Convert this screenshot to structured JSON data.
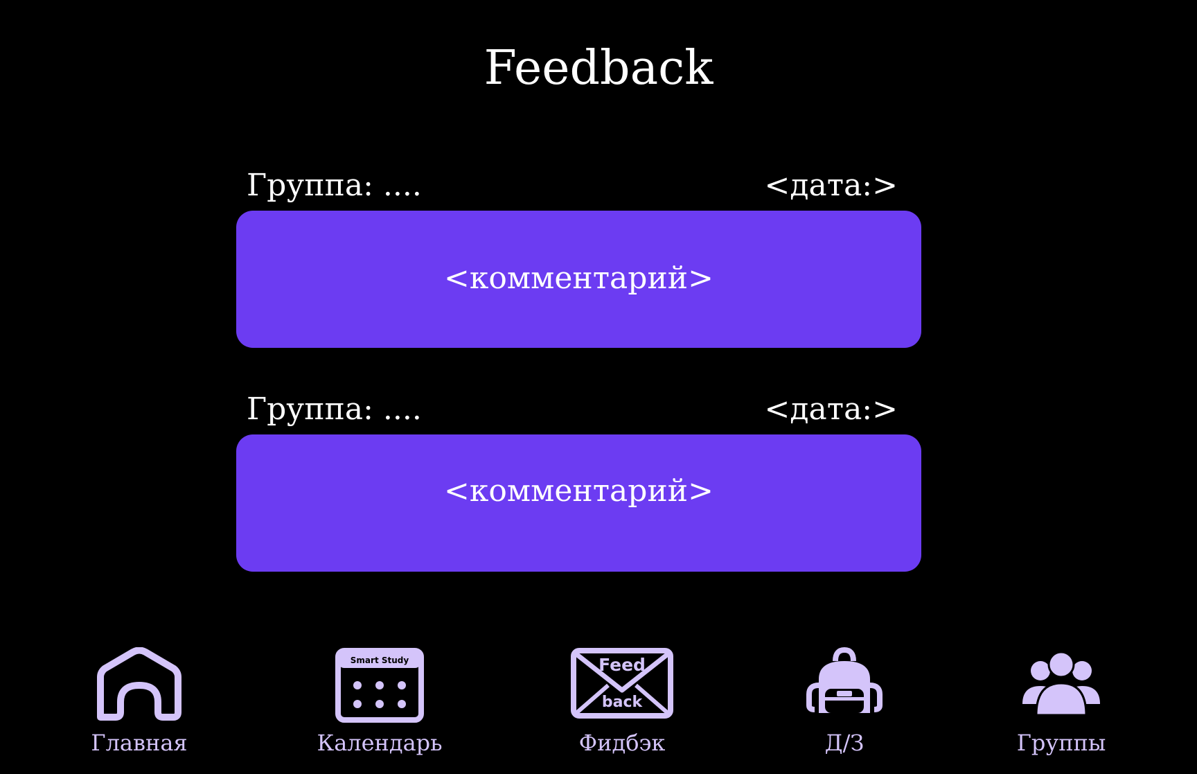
{
  "page": {
    "title": "Feedback"
  },
  "feedback_items": [
    {
      "group": "Группа: ....",
      "date": "<дата:>",
      "comment": "<комментарий>"
    },
    {
      "group": "Группа: ....",
      "date": "<дата:>",
      "comment": "<комментарий>"
    }
  ],
  "nav": {
    "items": [
      {
        "label": "Главная",
        "icon": "home-icon"
      },
      {
        "label": "Календарь",
        "icon": "calendar-icon",
        "icon_text": "Smart Study"
      },
      {
        "label": "Фидбэк",
        "icon": "feedback-envelope-icon",
        "icon_text_top": "Feed",
        "icon_text_bottom": "back"
      },
      {
        "label": "Д/З",
        "icon": "backpack-icon"
      },
      {
        "label": "Группы",
        "icon": "groups-icon"
      }
    ]
  },
  "colors": {
    "background": "#000000",
    "card": "#6c3cf2",
    "nav_accent": "#d4c4fa",
    "text": "#ffffff"
  }
}
